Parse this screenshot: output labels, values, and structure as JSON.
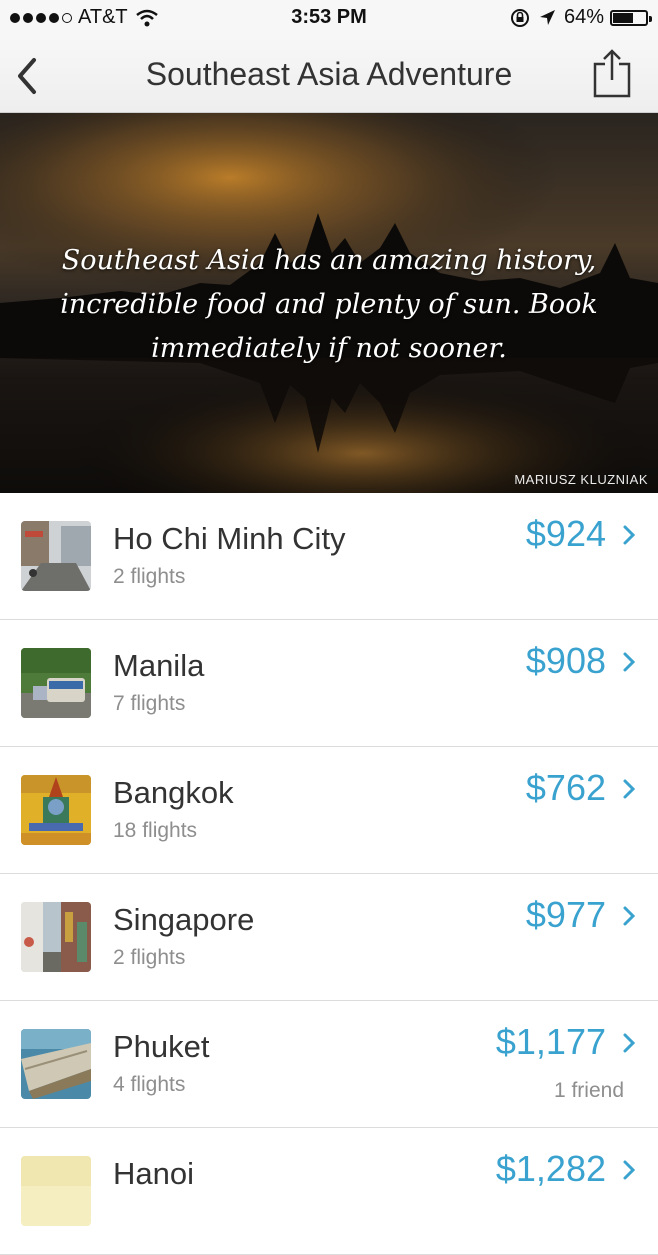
{
  "status_bar": {
    "carrier": "AT&T",
    "time": "3:53 PM",
    "battery": "64%",
    "battery_level": 0.64,
    "signal_dots": 4
  },
  "nav": {
    "title": "Southeast Asia Adventure",
    "back_icon": "chevron-left-icon",
    "share_icon": "share-icon"
  },
  "hero": {
    "quote": "Southeast Asia has an amazing history, incredible food and plenty of sun. Book immediately if not sooner.",
    "credit": "MARIUSZ KLUZNIAK"
  },
  "colors": {
    "accent": "#3aa2cf",
    "secondary_text": "#8e8e8e"
  },
  "destinations": [
    {
      "city": "Ho Chi Minh City",
      "flights": "2 flights",
      "price": "$924",
      "friend": ""
    },
    {
      "city": "Manila",
      "flights": "7 flights",
      "price": "$908",
      "friend": ""
    },
    {
      "city": "Bangkok",
      "flights": "18 flights",
      "price": "$762",
      "friend": ""
    },
    {
      "city": "Singapore",
      "flights": "2 flights",
      "price": "$977",
      "friend": ""
    },
    {
      "city": "Phuket",
      "flights": "4 flights",
      "price": "$1,177",
      "friend": "1 friend"
    },
    {
      "city": "Hanoi",
      "flights": "",
      "price": "$1,282",
      "friend": ""
    }
  ]
}
